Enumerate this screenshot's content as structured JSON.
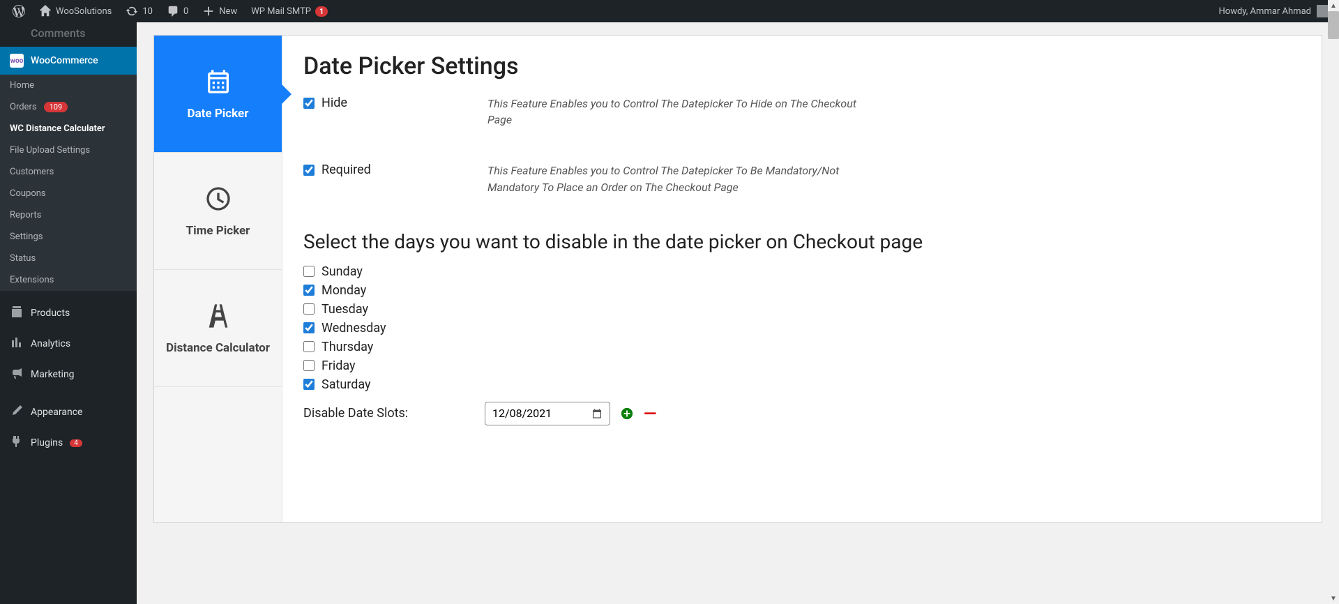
{
  "adminBar": {
    "siteName": "WooSolutions",
    "updates": "10",
    "comments": "0",
    "newLabel": "New",
    "wpMailSmtp": "WP Mail SMTP",
    "wpMailSmtpCount": "1",
    "howdy": "Howdy, Ammar Ahmad"
  },
  "sidebar": {
    "comments": "Comments",
    "woocommerce": "WooCommerce",
    "sub": {
      "home": "Home",
      "orders": "Orders",
      "ordersCount": "109",
      "wcDistance": "WC Distance Calculater",
      "fileUpload": "File Upload Settings",
      "customers": "Customers",
      "coupons": "Coupons",
      "reports": "Reports",
      "settings": "Settings",
      "status": "Status",
      "extensions": "Extensions"
    },
    "products": "Products",
    "analytics": "Analytics",
    "marketing": "Marketing",
    "appearance": "Appearance",
    "plugins": "Plugins",
    "pluginsCount": "4"
  },
  "tabs": {
    "datePicker": "Date Picker",
    "timePicker": "Time Picker",
    "distanceCalc": "Distance Calculator"
  },
  "settings": {
    "title": "Date Picker Settings",
    "hide": {
      "label": "Hide",
      "desc": "This Feature Enables you to Control The Datepicker To Hide on The Checkout Page"
    },
    "required": {
      "label": "Required",
      "desc": "This Feature Enables you to Control The Datepicker To Be Mandatory/Not Mandatory To Place an Order on The Checkout Page"
    },
    "daysHeading": "Select the days you want to disable in the date picker on Checkout page",
    "days": {
      "sunday": "Sunday",
      "monday": "Monday",
      "tuesday": "Tuesday",
      "wednesday": "Wednesday",
      "thursday": "Thursday",
      "friday": "Friday",
      "saturday": "Saturday"
    },
    "disableDateLabel": "Disable Date Slots:",
    "dateValue": "12/08/2021"
  }
}
